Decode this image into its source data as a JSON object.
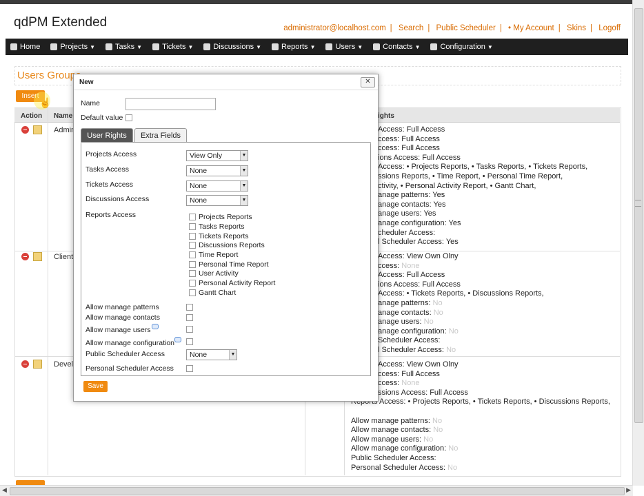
{
  "app": {
    "title": "qdPM Extended"
  },
  "top_links": [
    "administrator@localhost.com",
    "Search",
    "Public Scheduler",
    "• My Account",
    "Skins",
    "Logoff"
  ],
  "menu": [
    {
      "label": "Home",
      "icon": "home-icon"
    },
    {
      "label": "Projects",
      "icon": "projects-icon"
    },
    {
      "label": "Tasks",
      "icon": "tasks-icon"
    },
    {
      "label": "Tickets",
      "icon": "tickets-icon"
    },
    {
      "label": "Discussions",
      "icon": "discussions-icon"
    },
    {
      "label": "Reports",
      "icon": "reports-icon"
    },
    {
      "label": "Users",
      "icon": "users-icon"
    },
    {
      "label": "Contacts",
      "icon": "contacts-icon"
    },
    {
      "label": "Configuration",
      "icon": "gear-icon"
    }
  ],
  "page": {
    "title": "Users Groups",
    "insert_label": "Insert"
  },
  "table": {
    "headers": {
      "action": "Action",
      "name": "Name",
      "rights": "ights"
    },
    "rows": [
      {
        "name": "Admin",
        "rights": [
          "Access: Full Access",
          "ccess: Full Access",
          "ccess: Full Access",
          "ions Access: Full Access",
          "Access: • Projects Reports, • Tasks Reports, • Tickets Reports,",
          "ssions Reports, • Time Report, • Personal Time Report,",
          "ctivity, • Personal Activity Report, • Gantt Chart,",
          "anage patterns: Yes",
          "anage contacts: Yes",
          "anage users: Yes",
          "anage configuration: Yes",
          "cheduler Access:",
          "l Scheduler Access: Yes"
        ]
      },
      {
        "name": "Client",
        "rights": [
          "Access: View Own Olny",
          "ccess:",
          "Access: Full Access",
          "ions Access: Full Access",
          "Access: • Tickets Reports, • Discussions Reports,",
          "anage patterns:",
          "anage contacts:",
          "anage users:",
          "anage configuration:",
          "Scheduler Access:",
          "l Scheduler Access:"
        ],
        "dim_suffix": [
          "",
          "None",
          "",
          "",
          "",
          "No",
          "No",
          "No",
          "No",
          "",
          "No"
        ]
      },
      {
        "name": "Devel",
        "rights": [
          "Access: View Own Olny",
          "ccess: Full Access",
          "ccess:",
          "ssions Access: Full Access",
          "Reports Access: • Projects Reports, • Tickets Reports, • Discussions Reports,",
          "",
          "Allow manage patterns:",
          "Allow manage contacts:",
          "Allow manage users:",
          "Allow manage configuration:",
          "Public Scheduler Access:",
          "Personal Scheduler Access:"
        ],
        "dim_suffix": [
          "",
          "",
          "None",
          "",
          "",
          "",
          "No",
          "No",
          "No",
          "No",
          "",
          "No"
        ]
      }
    ]
  },
  "modal": {
    "title": "New",
    "close_label": "✕",
    "name_label": "Name",
    "name_value": "",
    "default_label": "Default value",
    "tabs": [
      "User Rights",
      "Extra Fields"
    ],
    "fields": [
      {
        "label": "Projects Access",
        "value": "View Only"
      },
      {
        "label": "Tasks Access",
        "value": "None"
      },
      {
        "label": "Tickets Access",
        "value": "None"
      },
      {
        "label": "Discussions Access",
        "value": "None"
      }
    ],
    "reports_label": "Reports Access",
    "reports": [
      "Projects Reports",
      "Tasks Reports",
      "Tickets Reports",
      "Discussions Reports",
      "Time Report",
      "Personal Time Report",
      "User Activity",
      "Personal Activity Report",
      "Gantt Chart"
    ],
    "allow": [
      "Allow manage patterns",
      "Allow manage contacts",
      "Allow manage users",
      "Allow manage configuration"
    ],
    "public_label": "Public Scheduler Access",
    "public_value": "None",
    "personal_label": "Personal Scheduler Access",
    "save_label": "Save"
  }
}
